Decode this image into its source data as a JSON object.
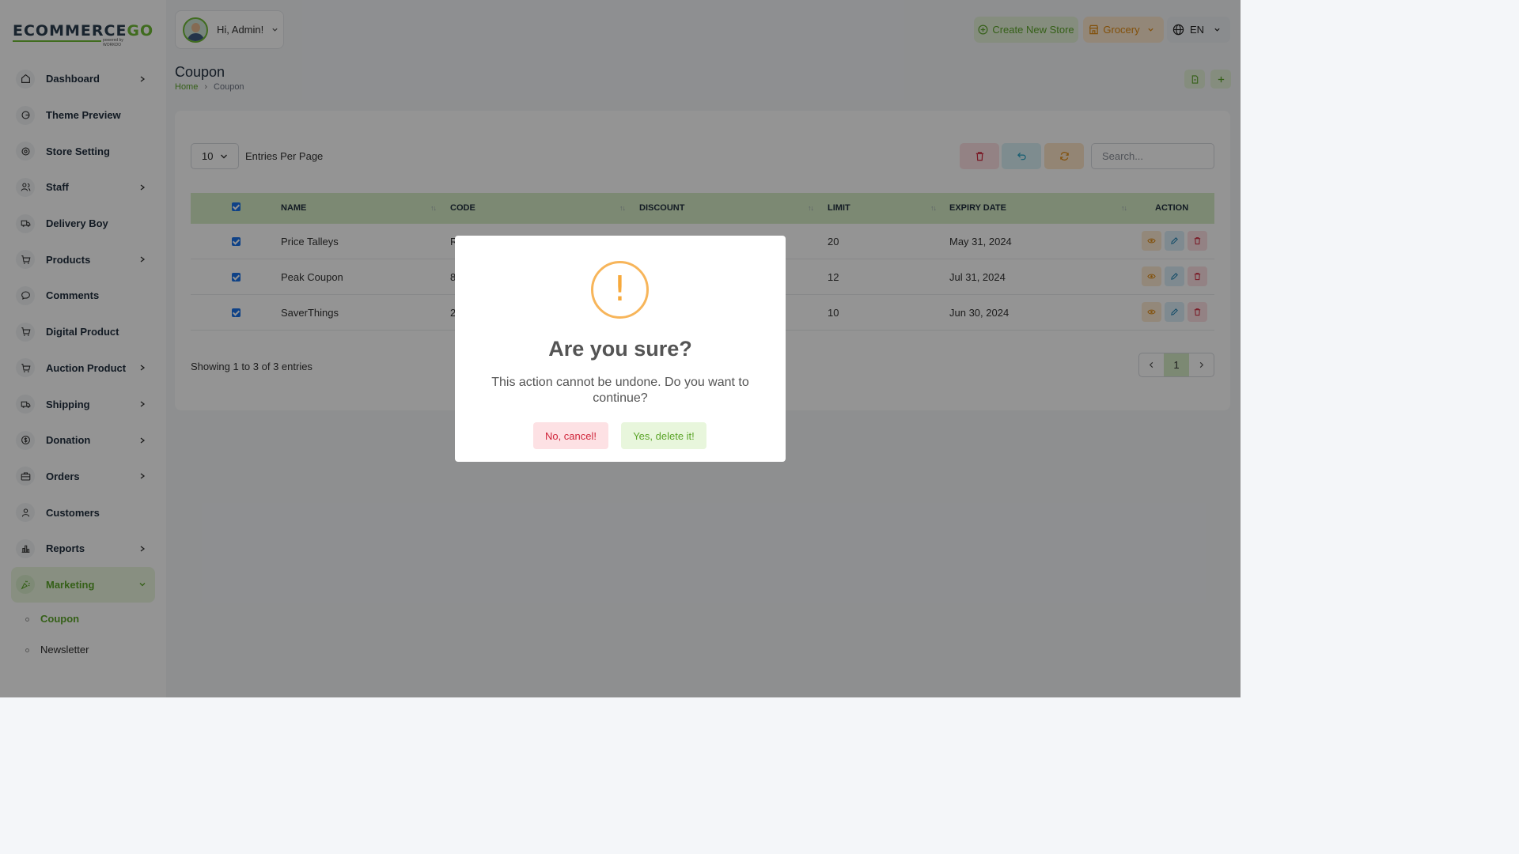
{
  "brand": {
    "logo_text_a": "ECOMMERCE",
    "logo_text_b": "GO",
    "logo_tagline": "powered by WORKDO"
  },
  "colors": {
    "accent": "#6fba36",
    "danger": "#d0263b",
    "warning": "#f7a93b",
    "info": "#29a3c4"
  },
  "sidebar": {
    "items": [
      {
        "label": "Dashboard",
        "icon": "home-icon",
        "has_children": true
      },
      {
        "label": "Theme Preview",
        "icon": "theme-preview-icon",
        "has_children": false
      },
      {
        "label": "Store Setting",
        "icon": "gear-icon",
        "has_children": false
      },
      {
        "label": "Staff",
        "icon": "users-icon",
        "has_children": true
      },
      {
        "label": "Delivery Boy",
        "icon": "truck-icon",
        "has_children": false
      },
      {
        "label": "Products",
        "icon": "cart-icon",
        "has_children": true
      },
      {
        "label": "Comments",
        "icon": "comment-icon",
        "has_children": false
      },
      {
        "label": "Digital Product",
        "icon": "cart-icon",
        "has_children": false
      },
      {
        "label": "Auction Product",
        "icon": "cart-icon",
        "has_children": true
      },
      {
        "label": "Shipping",
        "icon": "truck-icon",
        "has_children": true
      },
      {
        "label": "Donation",
        "icon": "coin-icon",
        "has_children": true
      },
      {
        "label": "Orders",
        "icon": "briefcase-icon",
        "has_children": true
      },
      {
        "label": "Customers",
        "icon": "user-icon",
        "has_children": false
      },
      {
        "label": "Reports",
        "icon": "chart-icon",
        "has_children": true
      },
      {
        "label": "Marketing",
        "icon": "marketing-icon",
        "has_children": true,
        "active": true
      }
    ],
    "submenu": [
      {
        "label": "Coupon",
        "active": true
      },
      {
        "label": "Newsletter",
        "active": false
      }
    ]
  },
  "header": {
    "greeting": "Hi, Admin!",
    "create_store": "Create New Store",
    "store_select": "Grocery",
    "language": "EN"
  },
  "page": {
    "title": "Coupon",
    "breadcrumb_home": "Home",
    "breadcrumb_current": "Coupon"
  },
  "table": {
    "per_page_value": "10",
    "per_page_label": "Entries Per Page",
    "search_placeholder": "Search...",
    "columns": [
      "NAME",
      "CODE",
      "DISCOUNT",
      "LIMIT",
      "EXPIRY DATE",
      "ACTION"
    ],
    "rows": [
      {
        "name": "Price Talleys",
        "code": "R",
        "discount": "",
        "limit": "20",
        "expiry": "May 31, 2024"
      },
      {
        "name": "Peak Coupon",
        "code": "8",
        "discount": "",
        "limit": "12",
        "expiry": "Jul 31, 2024"
      },
      {
        "name": "SaverThings",
        "code": "2",
        "discount": "",
        "limit": "10",
        "expiry": "Jun 30, 2024"
      }
    ],
    "showing": "Showing 1 to 3 of 3 entries",
    "current_page": "1"
  },
  "modal": {
    "icon": "!",
    "title": "Are you sure?",
    "message": "This action cannot be undone. Do you want to continue?",
    "cancel_label": "No, cancel!",
    "confirm_label": "Yes, delete it!"
  }
}
